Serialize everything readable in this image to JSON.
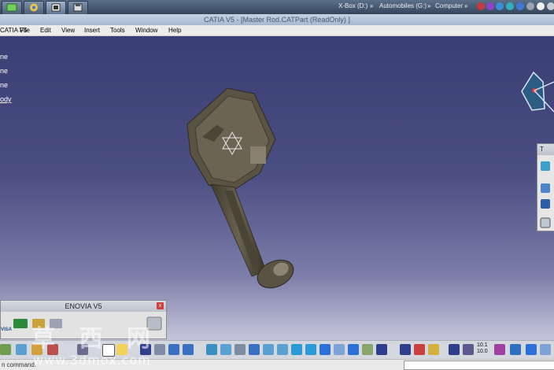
{
  "window": {
    "title": "CATIA V5 - [Master Rod.CATPart (ReadOnly) ]"
  },
  "taskbar": {
    "links": [
      "X-Box (D:)",
      "Automobiles (G:)",
      "Computer"
    ],
    "chevrons": [
      "»",
      "»",
      "»"
    ]
  },
  "menu": {
    "app_label": "CATIA V5",
    "items": [
      "File",
      "Edit",
      "View",
      "Insert",
      "Tools",
      "Window",
      "Help"
    ]
  },
  "tree": {
    "items": [
      "ne",
      "ne",
      "ne",
      "ody"
    ]
  },
  "enovia": {
    "title": "ENOVIA V5",
    "close": "x",
    "visa_label": "VISA"
  },
  "right_toolbar": {
    "title": "T"
  },
  "status": {
    "command_text": "n command."
  },
  "watermark": {
    "chars": "草 西 网",
    "url": "www.3dmox.com"
  },
  "toolbar_numbers": {
    "value_top": "10.1",
    "value_bottom": "10.0"
  },
  "colors": {
    "accent": "#3a3e76",
    "part": "#5b5446"
  }
}
